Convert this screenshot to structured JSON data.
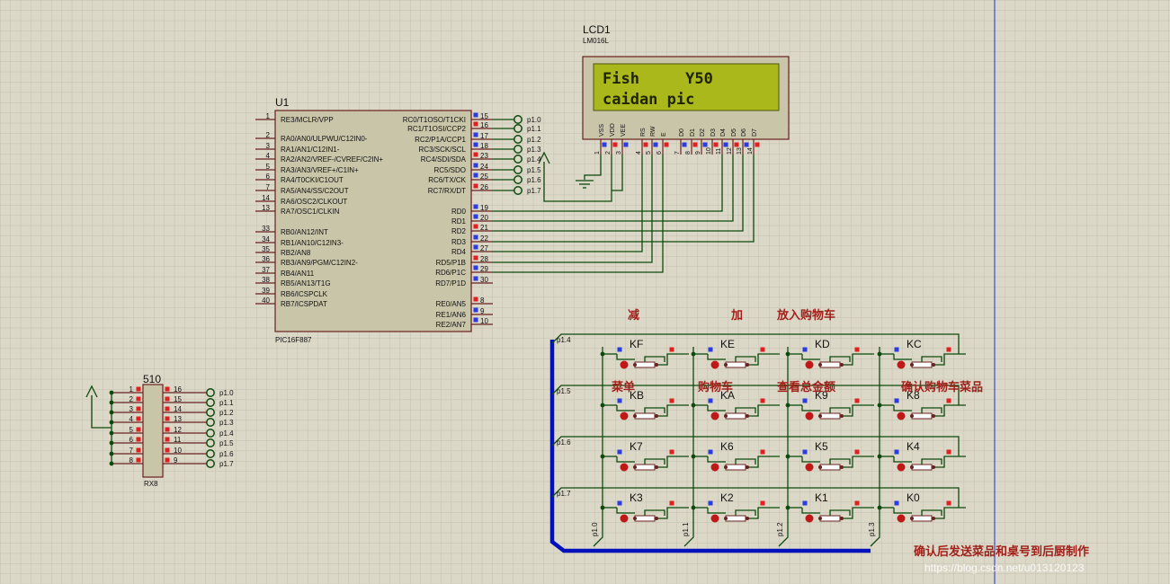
{
  "mcu": {
    "ref": "U1",
    "part": "PIC16F887",
    "left_pins": [
      {
        "num": "1",
        "name": "RE3/MCLR/VPP"
      },
      {
        "num": "2",
        "name": "RA0/AN0/ULPWU/C12IN0-"
      },
      {
        "num": "3",
        "name": "RA1/AN1/C12IN1-"
      },
      {
        "num": "4",
        "name": "RA2/AN2/VREF-/CVREF/C2IN+"
      },
      {
        "num": "5",
        "name": "RA3/AN3/VREF+/C1IN+"
      },
      {
        "num": "6",
        "name": "RA4/T0CKI/C1OUT"
      },
      {
        "num": "7",
        "name": "RA5/AN4/SS/C2OUT"
      },
      {
        "num": "14",
        "name": "RA6/OSC2/CLKOUT"
      },
      {
        "num": "13",
        "name": "RA7/OSC1/CLKIN"
      },
      {
        "num": "33",
        "name": "RB0/AN12/INT"
      },
      {
        "num": "34",
        "name": "RB1/AN10/C12IN3-"
      },
      {
        "num": "35",
        "name": "RB2/AN8"
      },
      {
        "num": "36",
        "name": "RB3/AN9/PGM/C12IN2-"
      },
      {
        "num": "37",
        "name": "RB4/AN11"
      },
      {
        "num": "38",
        "name": "RB5/AN13/T1G"
      },
      {
        "num": "39",
        "name": "RB6/ICSPCLK"
      },
      {
        "num": "40",
        "name": "RB7/ICSPDAT"
      }
    ],
    "right_pins": [
      {
        "num": "15",
        "name": "RC0/T1OSO/T1CKI",
        "net": "p1.0"
      },
      {
        "num": "16",
        "name": "RC1/T1OSI/CCP2",
        "net": "p1.1"
      },
      {
        "num": "17",
        "name": "RC2/P1A/CCP1",
        "net": "p1.2"
      },
      {
        "num": "18",
        "name": "RC3/SCK/SCL",
        "net": "p1.3"
      },
      {
        "num": "23",
        "name": "RC4/SDI/SDA",
        "net": "p1.4"
      },
      {
        "num": "24",
        "name": "RC5/SDO",
        "net": "p1.5"
      },
      {
        "num": "25",
        "name": "RC6/TX/CK",
        "net": "p1.6"
      },
      {
        "num": "26",
        "name": "RC7/RX/DT",
        "net": "p1.7"
      },
      {
        "num": "19",
        "name": "RD0",
        "net": ""
      },
      {
        "num": "20",
        "name": "RD1",
        "net": ""
      },
      {
        "num": "21",
        "name": "RD2",
        "net": ""
      },
      {
        "num": "22",
        "name": "RD3",
        "net": ""
      },
      {
        "num": "27",
        "name": "RD4",
        "net": ""
      },
      {
        "num": "28",
        "name": "RD5/P1B",
        "net": ""
      },
      {
        "num": "29",
        "name": "RD6/P1C",
        "net": ""
      },
      {
        "num": "30",
        "name": "RD7/P1D",
        "net": ""
      },
      {
        "num": "8",
        "name": "RE0/AN5",
        "net": ""
      },
      {
        "num": "9",
        "name": "RE1/AN6",
        "net": ""
      },
      {
        "num": "10",
        "name": "RE2/AN7",
        "net": ""
      }
    ]
  },
  "lcd": {
    "ref": "LCD1",
    "part": "LM016L",
    "line1": "Fish     Y50",
    "line2": "caidan pic",
    "pins": [
      {
        "name": "VSS",
        "num": "1"
      },
      {
        "name": "VDD",
        "num": "2"
      },
      {
        "name": "VEE",
        "num": "3"
      },
      {
        "name": "RS",
        "num": "4"
      },
      {
        "name": "RW",
        "num": "5"
      },
      {
        "name": "E",
        "num": "6"
      },
      {
        "name": "D0",
        "num": "7"
      },
      {
        "name": "D1",
        "num": "8"
      },
      {
        "name": "D2",
        "num": "9"
      },
      {
        "name": "D3",
        "num": "10"
      },
      {
        "name": "D4",
        "num": "11"
      },
      {
        "name": "D5",
        "num": "12"
      },
      {
        "name": "D6",
        "num": "13"
      },
      {
        "name": "D7",
        "num": "14"
      }
    ]
  },
  "rpack": {
    "value": "510",
    "part": "RX8",
    "left_pins": [
      "1",
      "2",
      "3",
      "4",
      "5",
      "6",
      "7",
      "8"
    ],
    "right_pins": [
      "16",
      "15",
      "14",
      "13",
      "12",
      "11",
      "10",
      "9"
    ],
    "nets": [
      "p1.0",
      "p1.1",
      "p1.2",
      "p1.3",
      "p1.4",
      "p1.5",
      "p1.6",
      "p1.7"
    ]
  },
  "keypad": {
    "keys": [
      "KF",
      "KE",
      "KD",
      "KC",
      "KB",
      "KA",
      "K9",
      "K8",
      "K7",
      "K6",
      "K5",
      "K4",
      "K3",
      "K2",
      "K1",
      "K0"
    ],
    "row_nets": [
      "p1.4",
      "p1.5",
      "p1.6",
      "p1.7"
    ],
    "col_nets": [
      "p1.0",
      "p1.1",
      "p1.2",
      "p1.3"
    ]
  },
  "annotations": {
    "minus": "减",
    "plus": "加",
    "add_to_cart": "放入购物车",
    "menu": "菜单",
    "cart": "购物车",
    "total": "查看总金额",
    "confirm_cart": "确认购物车菜品",
    "bottom_note": "确认后发送菜品和桌号到后厨制作",
    "watermark": "https://blog.csdn.net/u013120123"
  },
  "colors": {
    "background": "#dcd8c8",
    "grid": "#c3bfae",
    "wire": "#0d4a0d",
    "bus": "#0011bb",
    "chip_fill": "#c9c5a8",
    "lcd_bezel": "#c9c5a8",
    "lcd_screen": "#aab81c",
    "lcd_text": "#1f2400",
    "annotation": "#a0201a",
    "pin_red": "#e02020",
    "pin_blue": "#2a3be0"
  }
}
